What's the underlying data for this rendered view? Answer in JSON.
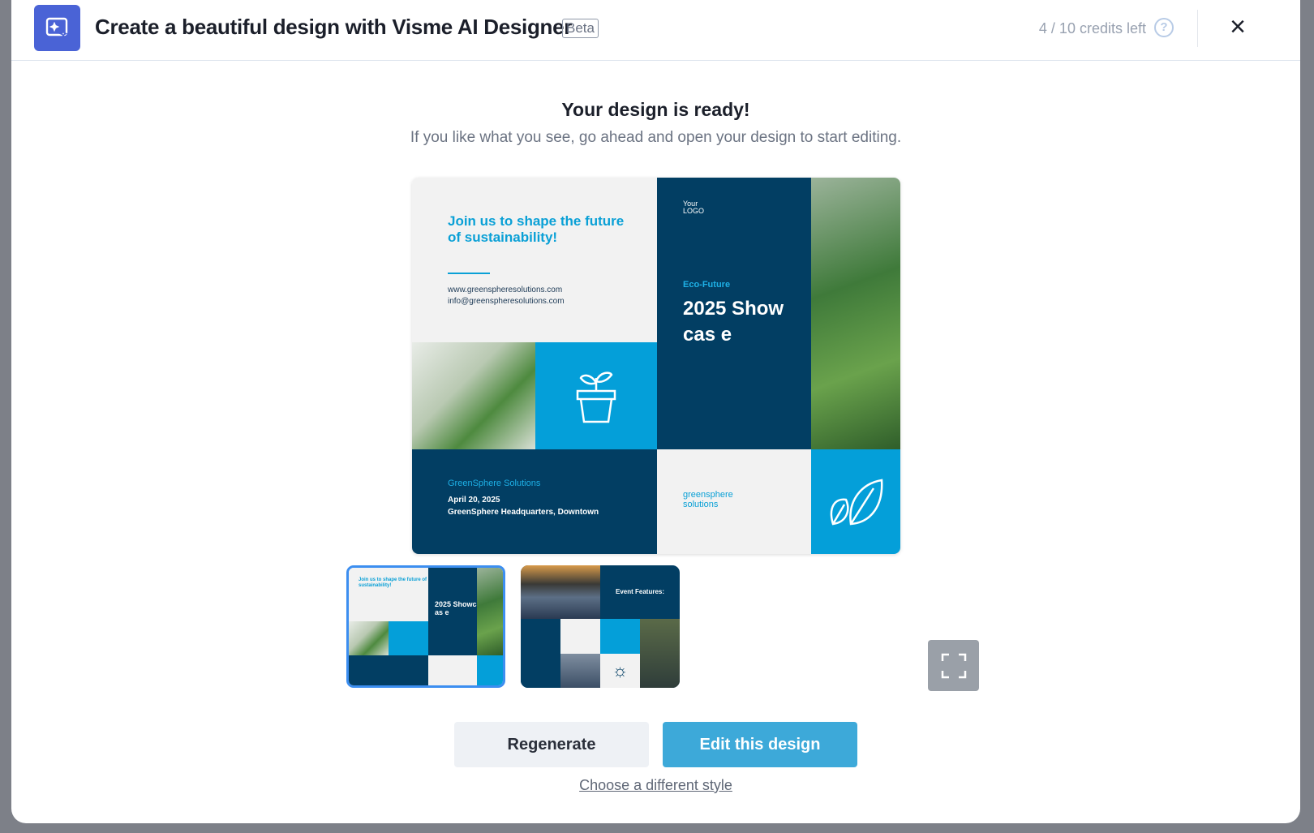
{
  "header": {
    "title": "Create a beautiful design with Visme AI Designer",
    "badge": "Beta",
    "credits": "4 / 10 credits left",
    "logo_icon": "ai-sparkle-icon",
    "help_icon": "question-circle-icon",
    "close_icon": "close-icon"
  },
  "main": {
    "heading": "Your design is ready!",
    "subtitle": "If you like what you see, go ahead and open your design to start editing."
  },
  "preview": {
    "headline": "Join us to shape the future of sustainability!",
    "website": "www.greenspheresolutions.com",
    "email": "info@greenspheresolutions.com",
    "logo_text": "Your LOGO",
    "eyebrow": "Eco-Future",
    "event_title": "2025 Showcas e",
    "company": "GreenSphere Solutions",
    "date": "April 20, 2025",
    "location": "GreenSphere Headquarters, Downtown",
    "brand": "greensphere solutions"
  },
  "thumbnails": [
    {
      "label": "Design option 1",
      "selected": true
    },
    {
      "label": "Design option 2",
      "selected": false,
      "title": "Event Features:"
    }
  ],
  "actions": {
    "regenerate": "Regenerate",
    "edit": "Edit this design",
    "change_style": "Choose a different style"
  },
  "colors": {
    "accent": "#3da9d9",
    "navy": "#023e63",
    "cyan": "#049fd9",
    "logo_bg": "#4a63d6"
  }
}
